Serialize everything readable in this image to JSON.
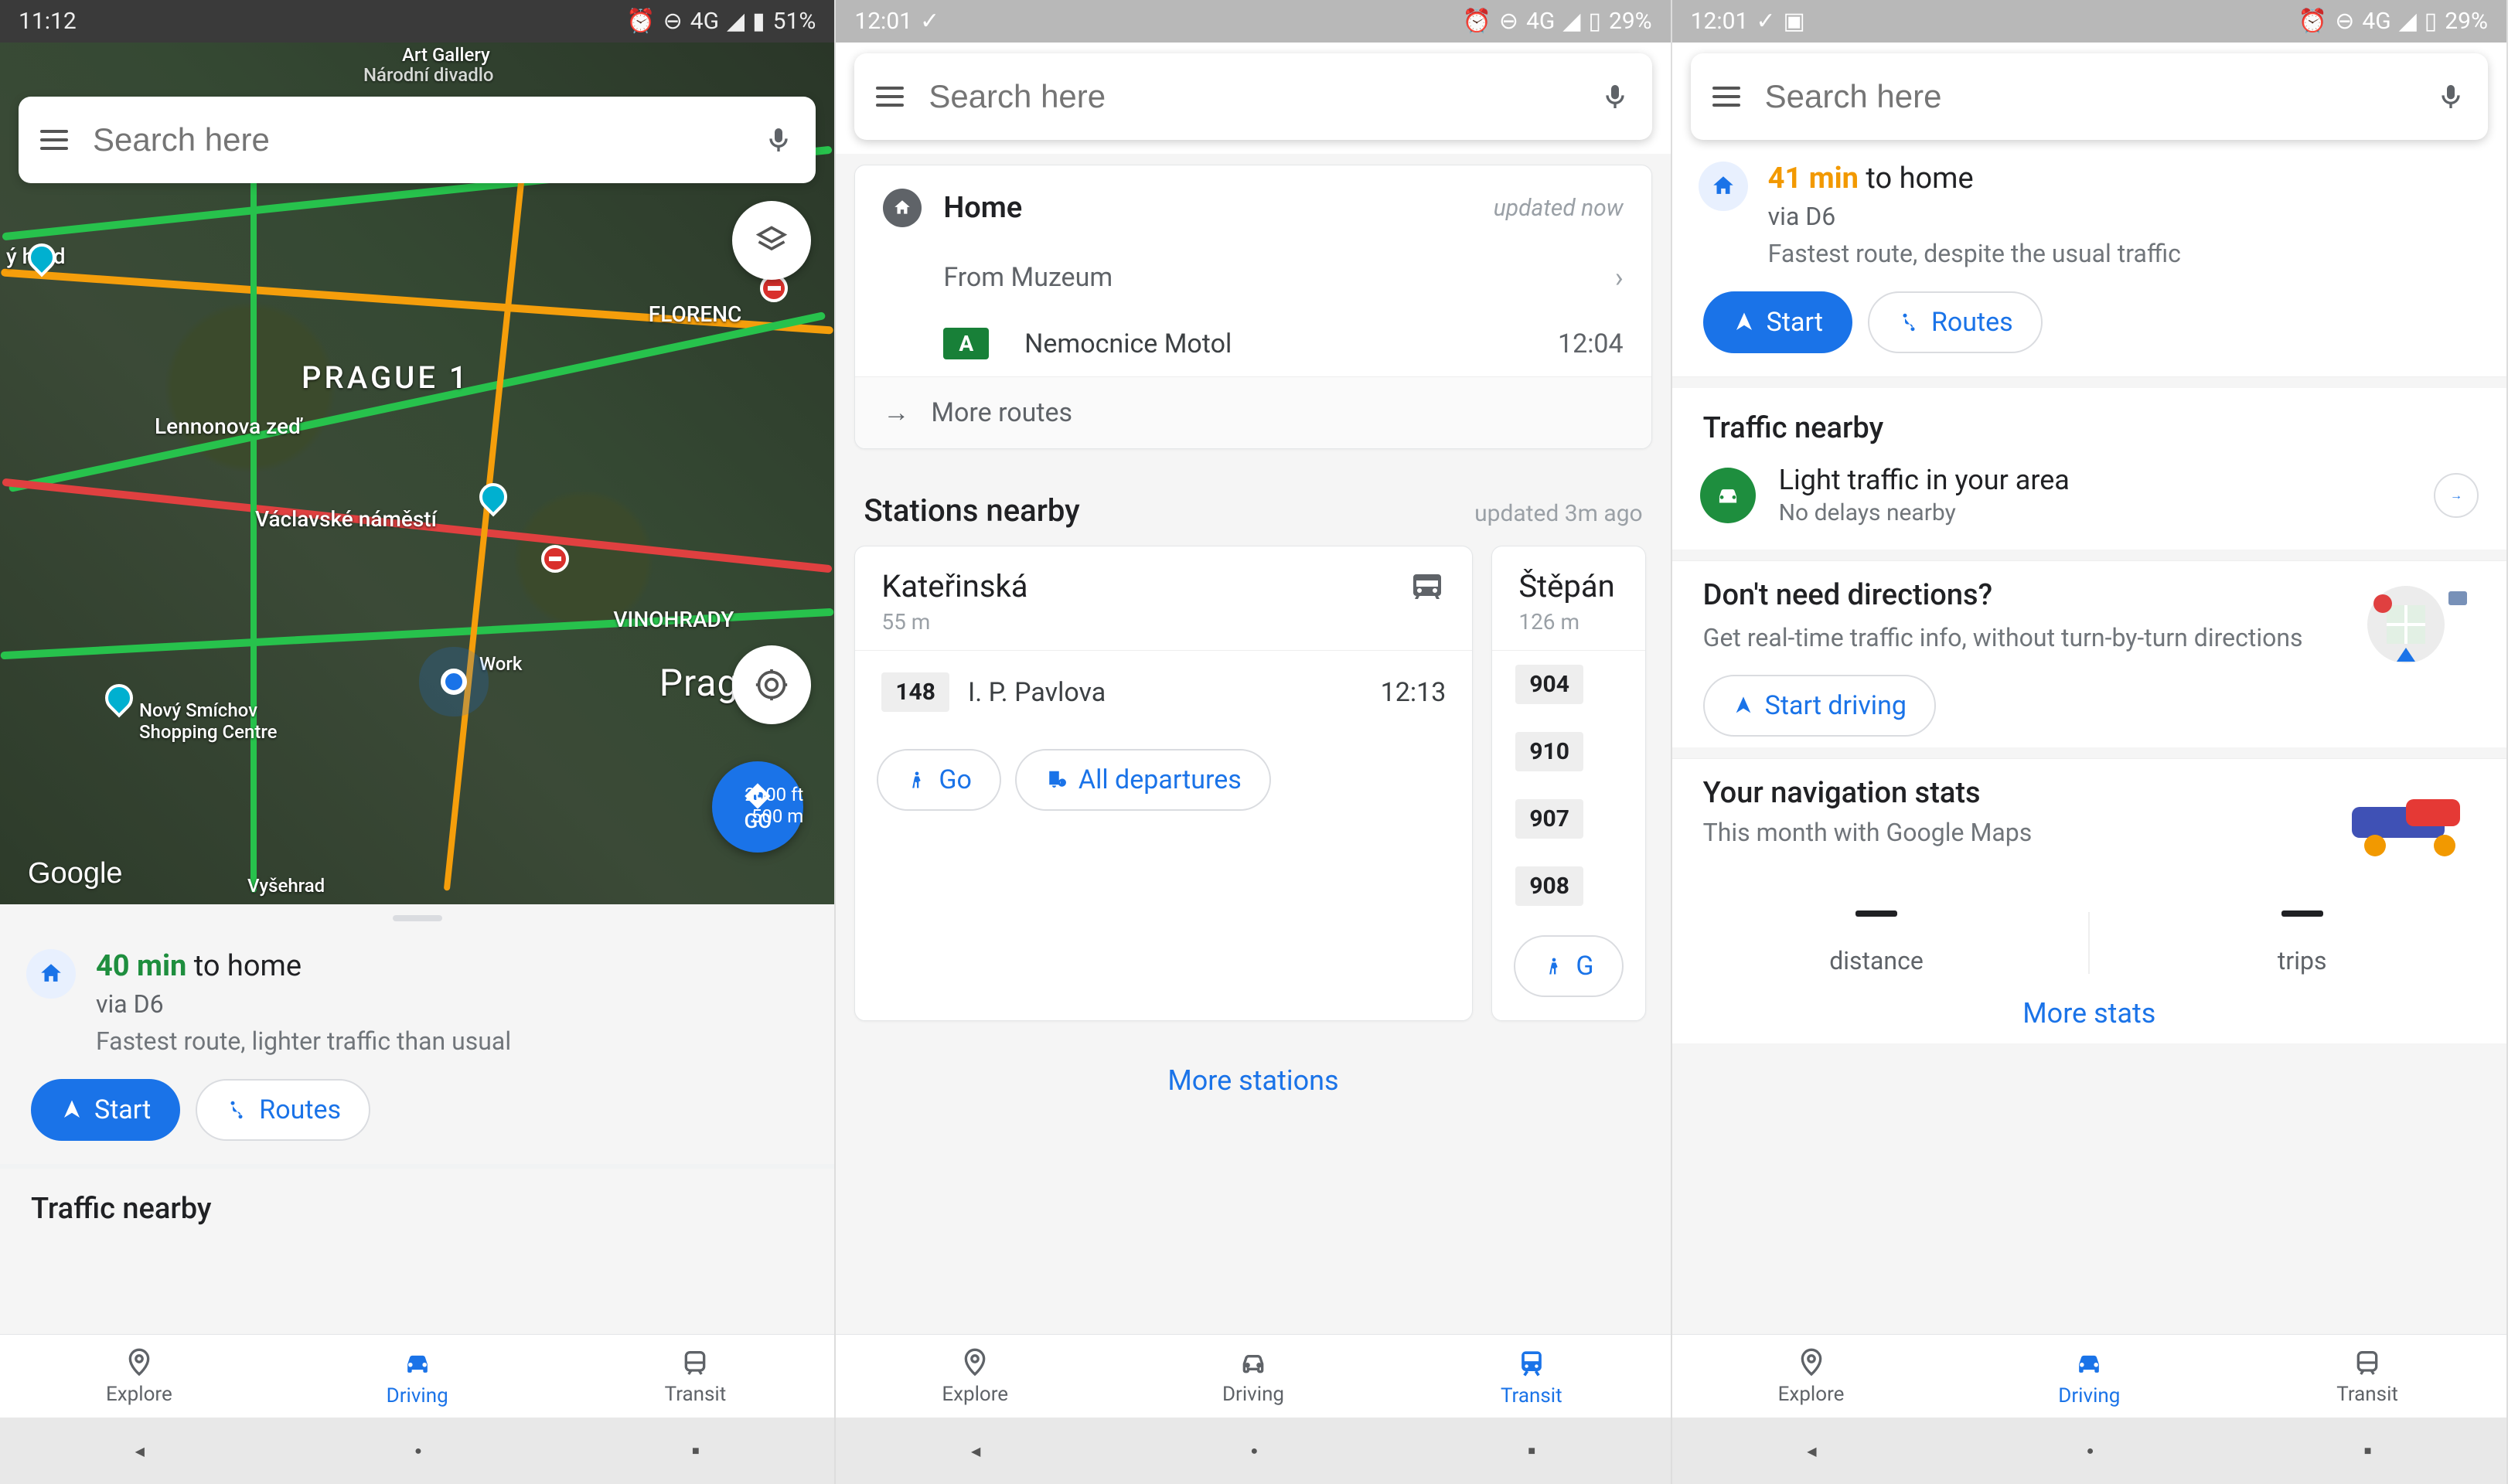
{
  "phones": [
    {
      "status": {
        "time": "11:12",
        "net": "4G",
        "battery": "51%"
      },
      "search_placeholder": "Search here",
      "map": {
        "labels": {
          "art_gallery": "Art Gallery",
          "narodni": "Národní divadlo",
          "prague1": "PRAGUE 1",
          "florenc": "FLORENC",
          "novy": "Nový Smíchov\nShopping Centre",
          "lennon": "Lennonova zeď",
          "vaclav": "Václavské náměstí",
          "vinohrady": "VINOHRADY",
          "prague": "Prague",
          "work": "Work",
          "hrad": "ý hrad",
          "vysehrad": "Vyšehrad"
        },
        "scale": {
          "ft": "2000 ft",
          "m": "500 m"
        },
        "go_fab": "GO",
        "watermark": "Google"
      },
      "route": {
        "eta": "40 min",
        "dest": "to home",
        "via": "via D6",
        "sub": "Fastest route, lighter traffic than usual"
      },
      "buttons": {
        "start": "Start",
        "routes": "Routes"
      },
      "section_traffic": "Traffic nearby",
      "nav": {
        "explore": "Explore",
        "driving": "Driving",
        "transit": "Transit",
        "active": "driving"
      }
    },
    {
      "status": {
        "time": "12:01",
        "net": "4G",
        "battery": "29%"
      },
      "search_placeholder": "Search here",
      "home_card": {
        "title": "Home",
        "updated": "updated now",
        "from": "From Muzeum",
        "line_letter": "A",
        "dest": "Nemocnice Motol",
        "time": "12:04",
        "more": "More routes"
      },
      "stations": {
        "header": "Stations nearby",
        "updated": "updated 3m ago",
        "cards": [
          {
            "name": "Kateřinská",
            "dist": "55 m",
            "dep": {
              "num": "148",
              "dest": "I. P. Pavlova",
              "time": "12:13"
            },
            "go": "Go",
            "all": "All departures"
          },
          {
            "name": "Štěpán",
            "dist": "126 m",
            "deps": [
              "904",
              "910",
              "907",
              "908"
            ],
            "go": "G"
          }
        ],
        "more": "More stations"
      },
      "nav": {
        "explore": "Explore",
        "driving": "Driving",
        "transit": "Transit",
        "active": "transit"
      }
    },
    {
      "status": {
        "time": "12:01",
        "net": "4G",
        "battery": "29%"
      },
      "search_placeholder": "Search here",
      "route": {
        "eta": "41 min",
        "dest": "to home",
        "via": "via D6",
        "sub": "Fastest route, despite the usual traffic"
      },
      "buttons": {
        "start": "Start",
        "routes": "Routes"
      },
      "section_traffic": "Traffic nearby",
      "traffic": {
        "title": "Light traffic in your area",
        "sub": "No delays nearby"
      },
      "nodir": {
        "title": "Don't need directions?",
        "sub": "Get real-time traffic info, without turn-by-turn directions",
        "start": "Start driving"
      },
      "stats": {
        "title": "Your navigation stats",
        "sub": "This month with Google Maps",
        "distance": "distance",
        "trips": "trips",
        "more": "More stats"
      },
      "nav": {
        "explore": "Explore",
        "driving": "Driving",
        "transit": "Transit",
        "active": "driving"
      }
    }
  ]
}
